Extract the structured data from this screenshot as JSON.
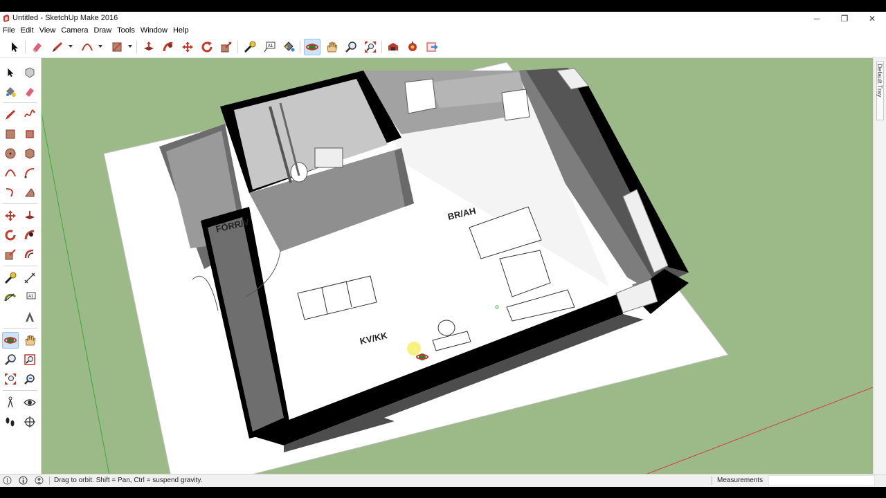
{
  "window": {
    "title": "Untitled - SketchUp Make 2016",
    "minimize_glyph": "─",
    "maximize_glyph": "❐",
    "close_glyph": "✕"
  },
  "menu": [
    "File",
    "Edit",
    "View",
    "Camera",
    "Draw",
    "Tools",
    "Window",
    "Help"
  ],
  "toolbar": {
    "icons": [
      "select-icon",
      "eraser-icon",
      "pencil-icon",
      "arc-icon",
      "rectangle-icon",
      "push-pull-icon",
      "follow-me-icon",
      "move-icon",
      "rotate-icon",
      "scale-icon",
      "tape-measure-icon",
      "text-icon",
      "paint-bucket-icon",
      "orbit-icon",
      "pan-icon",
      "zoom-icon",
      "zoom-extents-icon",
      "warehouse-icon",
      "extension-warehouse-icon",
      "send-to-layout-icon"
    ],
    "active": "orbit-icon"
  },
  "left_toolbar": {
    "active": "orbit-icon"
  },
  "viewport": {
    "sky_color": "#9cba88",
    "room_labels": {
      "hall": "FÖRR/V",
      "living": "BR/AH",
      "kitchen": "KV/KK"
    }
  },
  "right_panel": {
    "tray_label": "Default Tray"
  },
  "status": {
    "text": "Drag to orbit. Shift = Pan, Ctrl = suspend gravity.",
    "measurements_label": "Measurements",
    "measurements_value": ""
  },
  "colors": {
    "accent": "#cfe3f7",
    "red_axis": "#d23a3a",
    "green_axis": "#3aa83a"
  }
}
